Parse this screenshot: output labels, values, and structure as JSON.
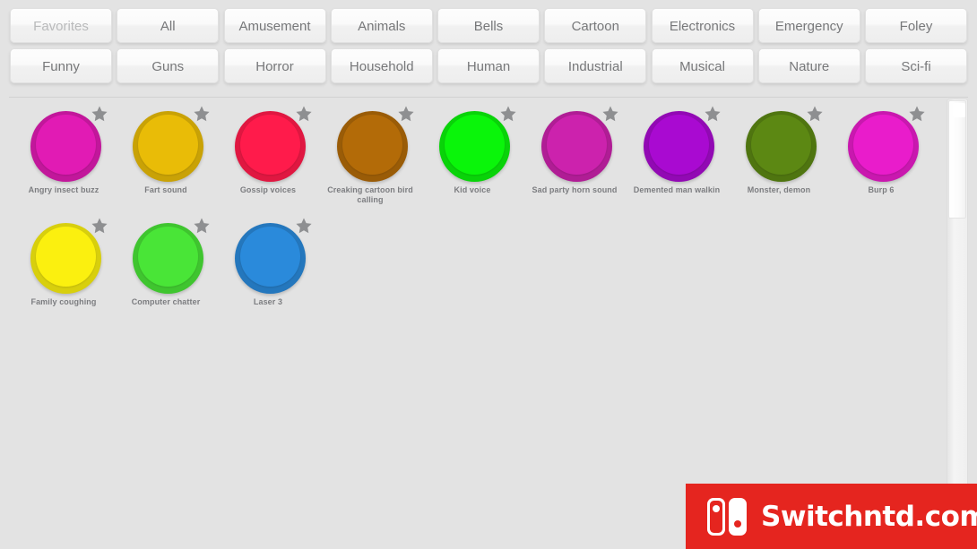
{
  "app": {
    "background_color": "#e3e3e3"
  },
  "tab_bar": {
    "rows": [
      [
        {
          "label": "Favorites",
          "muted": true
        },
        {
          "label": "All",
          "muted": false
        },
        {
          "label": "Amusement",
          "muted": false
        },
        {
          "label": "Animals",
          "muted": false
        },
        {
          "label": "Bells",
          "muted": false
        },
        {
          "label": "Cartoon",
          "muted": false
        },
        {
          "label": "Electronics",
          "muted": false
        },
        {
          "label": "Emergency",
          "muted": false
        },
        {
          "label": "Foley",
          "muted": false
        }
      ],
      [
        {
          "label": "Funny",
          "muted": false
        },
        {
          "label": "Guns",
          "muted": false
        },
        {
          "label": "Horror",
          "muted": false
        },
        {
          "label": "Household",
          "muted": false
        },
        {
          "label": "Human",
          "muted": false
        },
        {
          "label": "Industrial",
          "muted": false
        },
        {
          "label": "Musical",
          "muted": false
        },
        {
          "label": "Nature",
          "muted": false
        },
        {
          "label": "Sci-fi",
          "muted": false
        }
      ]
    ]
  },
  "sounds": [
    {
      "label": "Angry insect buzz",
      "color": "#c2179b",
      "starred": true
    },
    {
      "label": "Fart sound",
      "color": "#c9a206",
      "starred": true
    },
    {
      "label": "Gossip voices",
      "color": "#e01741",
      "starred": true
    },
    {
      "label": "Creaking cartoon bird calling",
      "color": "#9a5c07",
      "starred": true
    },
    {
      "label": "Kid voice",
      "color": "#09d309",
      "starred": true
    },
    {
      "label": "Sad party horn sound",
      "color": "#b01d95",
      "starred": true
    },
    {
      "label": "Demented man walkin",
      "color": "#9209b4",
      "starred": true
    },
    {
      "label": "Monster, demon",
      "color": "#4f7510",
      "starred": true
    },
    {
      "label": "Burp 6",
      "color": "#c918af",
      "starred": true
    },
    {
      "label": "Family coughing",
      "color": "#d8cf0d",
      "starred": true
    },
    {
      "label": "Computer chatter",
      "color": "#3fc52f",
      "starred": true
    },
    {
      "label": "Laser 3",
      "color": "#2477bd",
      "starred": true
    }
  ],
  "scrollbar": {
    "orientation": "vertical",
    "thumb_position_percent": 0
  },
  "watermark": {
    "text": "Switchntd.com",
    "background_color": "#e5251f",
    "logo_name": "nintendo-switch-logo"
  },
  "icons": {
    "star": "favorite-star-icon"
  }
}
